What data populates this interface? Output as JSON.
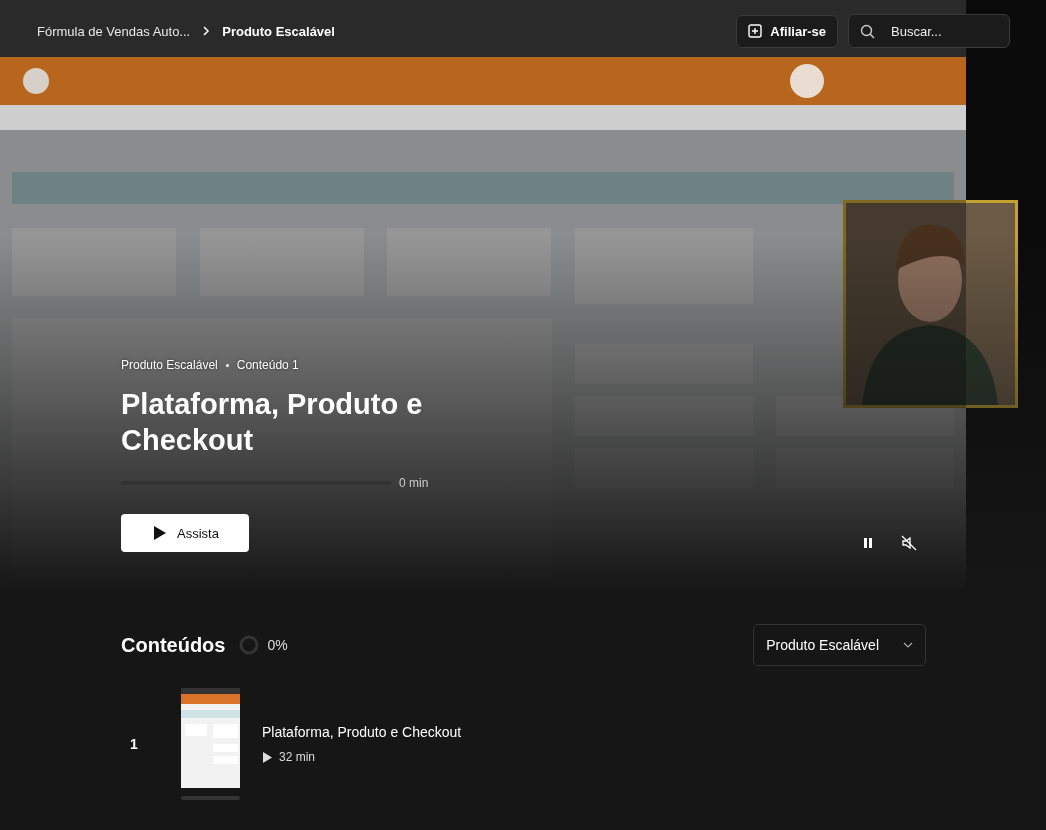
{
  "top_bar": {
    "breadcrumbs": [
      {
        "label": "Fórmula de Vendas Auto..."
      },
      {
        "label": "Produto Escalável"
      }
    ],
    "affiliate_button": "Afiliar-se",
    "search": {
      "placeholder": "Buscar..."
    }
  },
  "hero": {
    "kind": "picture",
    "course": "Produto Escalável",
    "lesson": "Conteúdo 1",
    "title": "Plataforma, Produto e Checkout",
    "progress": {
      "level": 0,
      "reading": "0 min"
    },
    "play_button": "Assista"
  },
  "contents": {
    "title": "Conteúdos",
    "progress": "0%",
    "module_select": "Produto Escalável",
    "items": [
      {
        "number": "1",
        "title": "Plataforma, Produto e Checkout",
        "duration": "32 min",
        "level": 0
      }
    ]
  }
}
